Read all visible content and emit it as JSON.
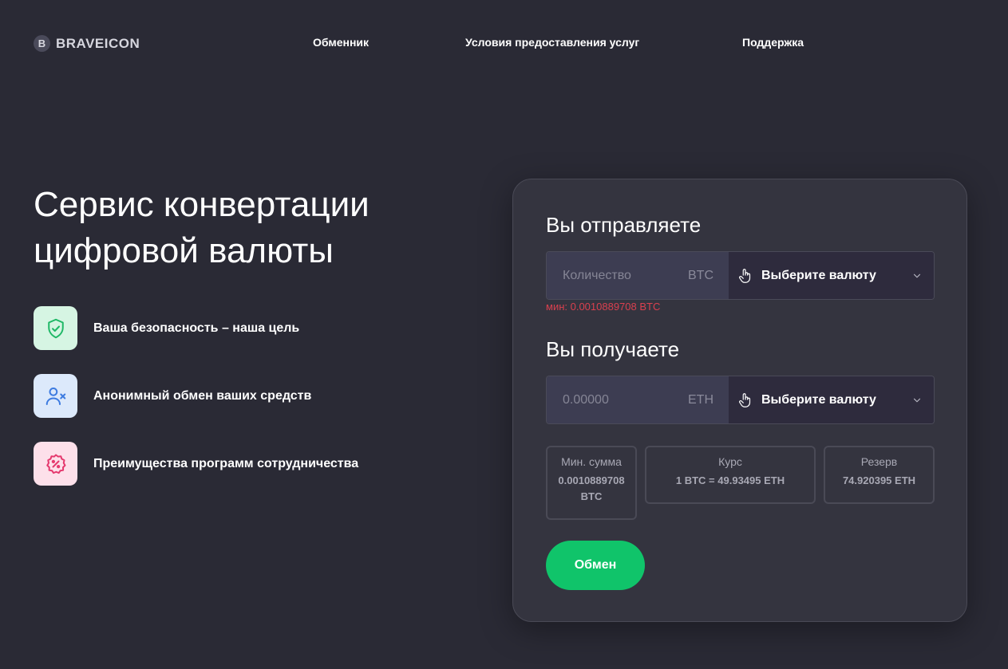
{
  "header": {
    "logo_letter": "B",
    "logo_text": "BRAVEICON",
    "nav": [
      "Обменник",
      "Условия предоставления услуг",
      "Поддержка"
    ]
  },
  "hero": {
    "title_line1": "Сервис конвертации",
    "title_line2": "цифровой валюты",
    "features": [
      {
        "text": "Ваша безопасность – наша цель",
        "icon": "shield-check-icon",
        "bg": "#d6f5e3",
        "color": "#1fb866"
      },
      {
        "text": "Анонимный обмен ваших средств",
        "icon": "user-x-icon",
        "bg": "#dce9fb",
        "color": "#3d7be0"
      },
      {
        "text": "Преимущества программ сотрудничества",
        "icon": "discount-badge-icon",
        "bg": "#fde0ea",
        "color": "#e5396e"
      }
    ]
  },
  "exchange": {
    "send_title": "Вы отправляете",
    "send_placeholder": "Количество",
    "send_unit": "BTC",
    "send_currency_label": "Выберите валюту",
    "min_text": "мин: 0.0010889708 BTC",
    "receive_title": "Вы получаете",
    "receive_placeholder": "0.00000",
    "receive_unit": "ETH",
    "receive_currency_label": "Выберите валюту",
    "stats": {
      "min": {
        "label": "Мин. сумма",
        "value_line1": "0.0010889708",
        "value_line2": "BTC"
      },
      "rate": {
        "label": "Курс",
        "value": "1 BTC = 49.93495 ETH"
      },
      "reserve": {
        "label": "Резерв",
        "value": "74.920395 ETH"
      }
    },
    "button_label": "Обмен"
  },
  "colors": {
    "background": "#2a2a35",
    "card": "#34343f",
    "accent_green": "#10c46a",
    "error_red": "#d9404f"
  }
}
